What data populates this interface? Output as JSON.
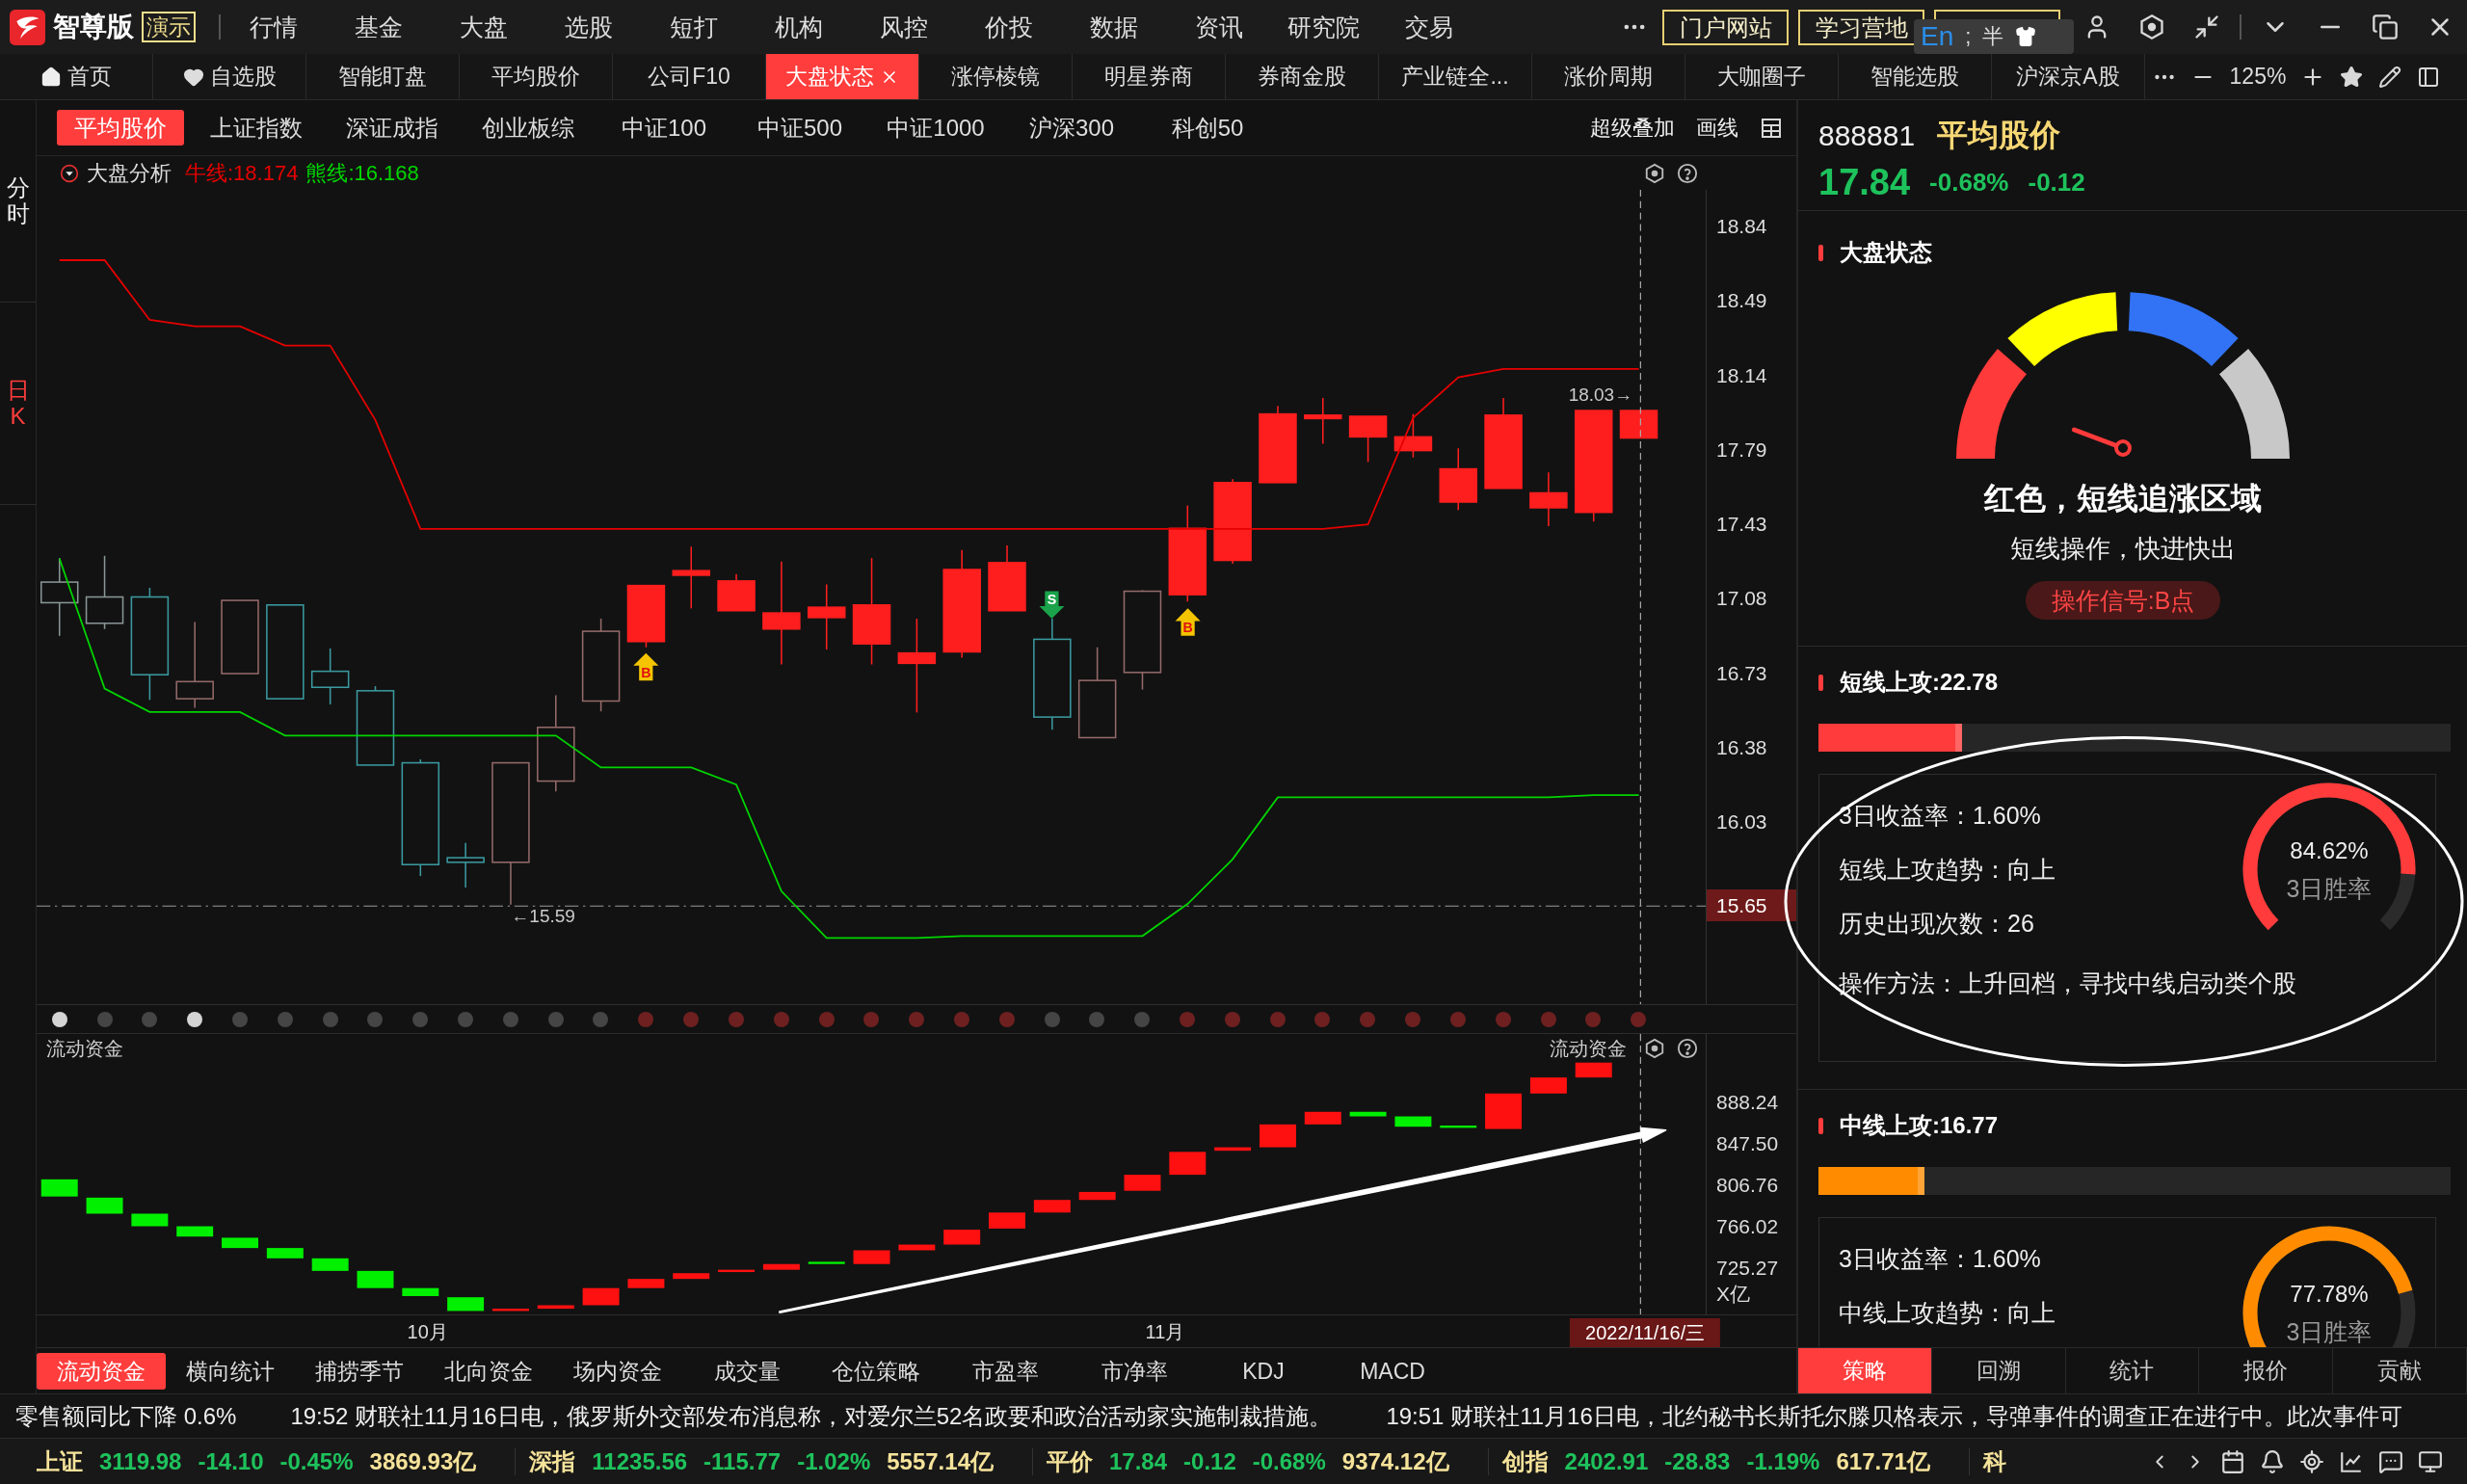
{
  "app": {
    "brand": "智尊版",
    "badge": "演示"
  },
  "menu": [
    "行情",
    "基金",
    "大盘",
    "选股",
    "短打",
    "机构",
    "风控",
    "价投",
    "数据",
    "资讯",
    "研究院",
    "交易"
  ],
  "links": [
    "门户网站",
    "学习营地"
  ],
  "ime": {
    "mode": "En",
    "punctuation": ";",
    "width": "半"
  },
  "tabs": [
    {
      "label": "首页",
      "kind": "home",
      "selected": false
    },
    {
      "label": "自选股",
      "kind": "favorites",
      "selected": false
    },
    {
      "label": "智能盯盘",
      "kind": "page",
      "selected": false
    },
    {
      "label": "平均股价",
      "kind": "page",
      "selected": false
    },
    {
      "label": "公司F10",
      "kind": "page",
      "selected": false
    },
    {
      "label": "大盘状态",
      "kind": "page",
      "selected": true
    },
    {
      "label": "涨停棱镜",
      "kind": "page",
      "selected": false
    },
    {
      "label": "明星券商",
      "kind": "page",
      "selected": false
    },
    {
      "label": "券商金股",
      "kind": "page",
      "selected": false
    },
    {
      "label": "产业链全...",
      "kind": "page",
      "selected": false
    },
    {
      "label": "涨价周期",
      "kind": "page",
      "selected": false
    },
    {
      "label": "大咖圈子",
      "kind": "page",
      "selected": false
    },
    {
      "label": "智能选股",
      "kind": "page",
      "selected": false
    },
    {
      "label": "沪深京A股",
      "kind": "page",
      "selected": false
    }
  ],
  "zoom_level": "125%",
  "side_tabs": [
    {
      "label": "分时",
      "selected": false
    },
    {
      "label": "日K",
      "selected": true
    }
  ],
  "index_tabs": [
    {
      "label": "平均股价",
      "selected": true
    },
    {
      "label": "上证指数",
      "selected": false
    },
    {
      "label": "深证成指",
      "selected": false
    },
    {
      "label": "创业板综",
      "selected": false
    },
    {
      "label": "中证100",
      "selected": false
    },
    {
      "label": "中证500",
      "selected": false
    },
    {
      "label": "中证1000",
      "selected": false
    },
    {
      "label": "沪深300",
      "selected": false
    },
    {
      "label": "科创50",
      "selected": false
    }
  ],
  "chart_tools": [
    "超级叠加",
    "画线"
  ],
  "main_chart": {
    "title": "大盘分析",
    "chart_data": {
      "type": "line",
      "ylim": [
        15.19,
        19.01
      ],
      "yticks": [
        18.84,
        18.49,
        18.14,
        17.79,
        17.43,
        17.08,
        16.73,
        16.38,
        16.03
      ],
      "ref_lines": [
        {
          "axis": "y",
          "value": 15.65,
          "label": "15.65",
          "color": "#9a9a9a"
        }
      ],
      "series": [
        {
          "name": "牛线:18.174",
          "color": "#e60000",
          "values": [
            18.68,
            18.68,
            18.4,
            18.37,
            18.37,
            18.28,
            18.28,
            17.93,
            17.42,
            17.42,
            17.42,
            17.42,
            17.42,
            17.42,
            17.42,
            17.42,
            17.42,
            17.42,
            17.42,
            17.42,
            17.42,
            17.42,
            17.42,
            17.42,
            17.42,
            17.42,
            17.42,
            17.42,
            17.42,
            17.44,
            17.94,
            18.13,
            18.17,
            18.17,
            18.17,
            18.17
          ]
        },
        {
          "name": "熊线:16.168",
          "color": "#00d400",
          "values": [
            17.28,
            16.67,
            16.56,
            16.56,
            16.56,
            16.45,
            16.45,
            16.45,
            16.45,
            16.45,
            16.45,
            16.45,
            16.3,
            16.3,
            16.3,
            16.22,
            15.72,
            15.5,
            15.5,
            15.5,
            15.51,
            15.51,
            15.51,
            15.51,
            15.51,
            15.66,
            15.87,
            16.16,
            16.16,
            16.16,
            16.16,
            16.16,
            16.16,
            16.16,
            16.17,
            16.17
          ]
        }
      ]
    },
    "high_note": "18.03→",
    "low_note": "←15.59",
    "signals": [
      {
        "kind": "buy",
        "label": "B"
      },
      {
        "kind": "sell",
        "label": "S"
      },
      {
        "kind": "buy",
        "label": "B"
      }
    ]
  },
  "status_dots": [
    {
      "color": "#d4d4d4"
    },
    {
      "color": "#454545"
    },
    {
      "color": "#454545"
    },
    {
      "color": "#d4d4d4"
    },
    {
      "color": "#454545"
    },
    {
      "color": "#454545"
    },
    {
      "color": "#454545"
    },
    {
      "color": "#454545"
    },
    {
      "color": "#454545"
    },
    {
      "color": "#454545"
    },
    {
      "color": "#454545"
    },
    {
      "color": "#454545"
    },
    {
      "color": "#454545"
    },
    {
      "color": "#6e2020"
    },
    {
      "color": "#6e2020"
    },
    {
      "color": "#6e2020"
    },
    {
      "color": "#6e2020"
    },
    {
      "color": "#6e2020"
    },
    {
      "color": "#6e2020"
    },
    {
      "color": "#6e2020"
    },
    {
      "color": "#6e2020"
    },
    {
      "color": "#6e2020"
    },
    {
      "color": "#454545"
    },
    {
      "color": "#454545"
    },
    {
      "color": "#454545"
    },
    {
      "color": "#6e2020"
    },
    {
      "color": "#6e2020"
    },
    {
      "color": "#6e2020"
    },
    {
      "color": "#6e2020"
    },
    {
      "color": "#6e2020"
    },
    {
      "color": "#6e2020"
    },
    {
      "color": "#6e2020"
    },
    {
      "color": "#6e2020"
    },
    {
      "color": "#6e2020"
    },
    {
      "color": "#6e2020"
    },
    {
      "color": "#6e2020"
    }
  ],
  "flow_chart": {
    "title": "流动资金",
    "legend": "流动资金",
    "y_labels": [
      "888.24",
      "847.50",
      "806.76",
      "766.02",
      "725.27"
    ],
    "unit": "X亿"
  },
  "x_axis": {
    "labels": [
      "10月",
      "11月"
    ],
    "cursor_date": "2022/11/16/三"
  },
  "indicator_tabs": [
    {
      "label": "流动资金",
      "selected": true
    },
    {
      "label": "横向统计",
      "selected": false
    },
    {
      "label": "捕捞季节",
      "selected": false
    },
    {
      "label": "北向资金",
      "selected": false
    },
    {
      "label": "场内资金",
      "selected": false
    },
    {
      "label": "成交量",
      "selected": false
    },
    {
      "label": "仓位策略",
      "selected": false
    },
    {
      "label": "市盈率",
      "selected": false
    },
    {
      "label": "市净率",
      "selected": false
    },
    {
      "label": "KDJ",
      "selected": false
    },
    {
      "label": "MACD",
      "selected": false
    }
  ],
  "quote": {
    "code": "888881",
    "name": "平均股价",
    "price": "17.84",
    "change_pct": "-0.68%",
    "change": "-0.12"
  },
  "market_state": {
    "title": "大盘状态",
    "zones": [
      {
        "color": "#ff3a3a",
        "selected": true
      },
      {
        "color": "#ffff00",
        "selected": false
      },
      {
        "color": "#3273f5",
        "selected": false
      },
      {
        "color": "#c8c8c8",
        "selected": false
      }
    ],
    "zone": "红色，短线追涨区域",
    "advice": "短线操作，快进快出",
    "signal": "操作信号:B点"
  },
  "strategies": [
    {
      "title": "短线上攻:22.78",
      "level": 0.2278,
      "color": "#ff3b3b",
      "lines": [
        "3日收益率：1.60%",
        "短线上攻趋势：向上",
        "历史出现次数：26"
      ],
      "method": "操作方法：上升回档，寻找中线启动类个股",
      "win_rate": {
        "value": "84.62%",
        "label": "3日胜率"
      }
    },
    {
      "title": "中线上攻:16.77",
      "level": 0.1677,
      "color": "#ff8c00",
      "lines": [
        "3日收益率：1.60%",
        "中线上攻趋势：向上"
      ],
      "win_rate": {
        "value": "77.78%",
        "label": "3日胜率"
      }
    }
  ],
  "panel_tabs": [
    {
      "label": "策略",
      "selected": true
    },
    {
      "label": "回溯",
      "selected": false
    },
    {
      "label": "统计",
      "selected": false
    },
    {
      "label": "报价",
      "selected": false
    },
    {
      "label": "贡献",
      "selected": false
    }
  ],
  "news": [
    "零售额同比下降 0.6%",
    "19:52 财联社11月16日电，俄罗斯外交部发布消息称，对爱尔兰52名政要和政治活动家实施制裁措施。",
    "19:51 财联社11月16日电，北约秘书长斯托尔滕贝格表示，导弹事件的调查正在进行中。此次事件可"
  ],
  "indices": [
    {
      "name": "上证",
      "value": "3119.98",
      "change": "-14.10",
      "pct": "-0.45%",
      "amount": "3869.93亿"
    },
    {
      "name": "深指",
      "value": "11235.56",
      "change": "-115.77",
      "pct": "-1.02%",
      "amount": "5557.14亿"
    },
    {
      "name": "平价",
      "value": "17.84",
      "change": "-0.12",
      "pct": "-0.68%",
      "amount": "9374.12亿"
    },
    {
      "name": "创指",
      "value": "2402.91",
      "change": "-28.83",
      "pct": "-1.19%",
      "amount": "617.71亿"
    },
    {
      "name": "科"
    }
  ]
}
